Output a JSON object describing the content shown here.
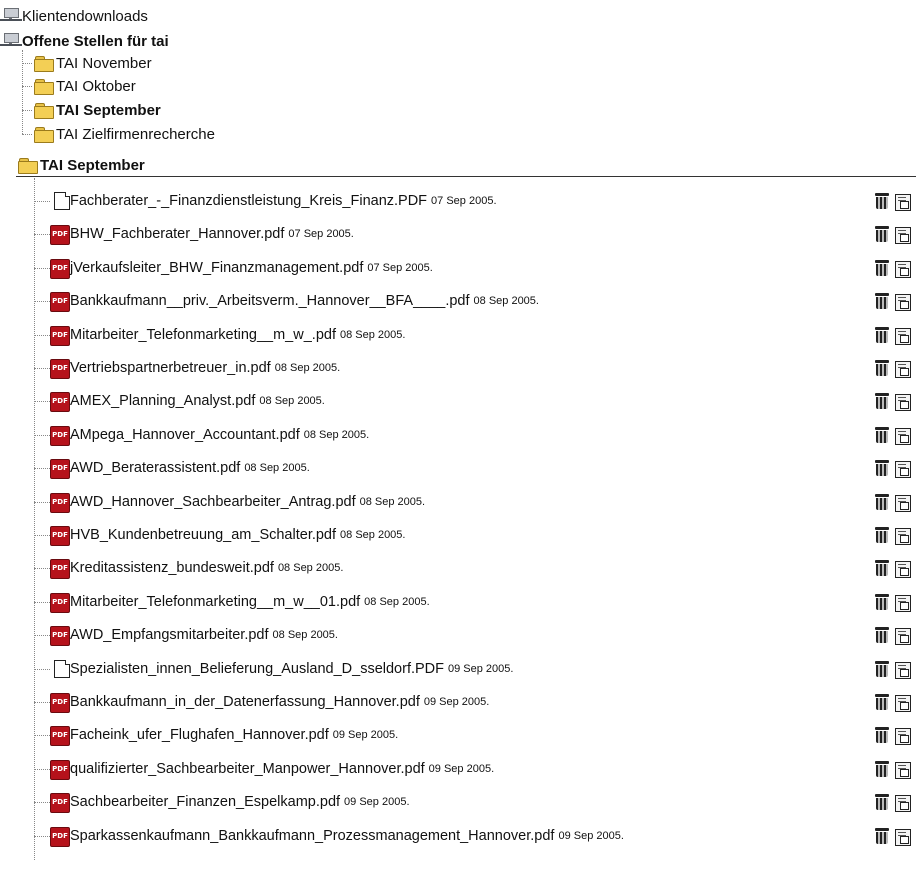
{
  "tree": {
    "root_items": [
      {
        "label": "Klientendownloads",
        "bold": false
      },
      {
        "label": "Offene Stellen für tai",
        "bold": true
      }
    ],
    "folders": [
      {
        "label": "TAI November",
        "bold": false
      },
      {
        "label": "TAI Oktober",
        "bold": false
      },
      {
        "label": "TAI September",
        "bold": true
      },
      {
        "label": "TAI Zielfirmenrecherche",
        "bold": false
      }
    ]
  },
  "section": {
    "title": "TAI September"
  },
  "files": [
    {
      "name": "Fachberater_-_Finanzdienstleistung_Kreis_Finanz.PDF",
      "date": "07 Sep 2005.",
      "icon": "document-icon"
    },
    {
      "name": "BHW_Fachberater_Hannover.pdf",
      "date": "07 Sep 2005.",
      "icon": "pdf-icon"
    },
    {
      "name": "jVerkaufsleiter_BHW_Finanzmanagement.pdf",
      "date": "07 Sep 2005.",
      "icon": "pdf-icon"
    },
    {
      "name": "Bankkaufmann__priv._Arbeitsverm._Hannover__BFA____.pdf",
      "date": "08 Sep 2005.",
      "icon": "pdf-icon"
    },
    {
      "name": "Mitarbeiter_Telefonmarketing__m_w_.pdf",
      "date": "08 Sep 2005.",
      "icon": "pdf-icon"
    },
    {
      "name": "Vertriebspartnerbetreuer_in.pdf",
      "date": "08 Sep 2005.",
      "icon": "pdf-icon"
    },
    {
      "name": "AMEX_Planning_Analyst.pdf",
      "date": "08 Sep 2005.",
      "icon": "pdf-icon"
    },
    {
      "name": "AMpega_Hannover_Accountant.pdf",
      "date": "08 Sep 2005.",
      "icon": "pdf-icon"
    },
    {
      "name": "AWD_Beraterassistent.pdf",
      "date": "08 Sep 2005.",
      "icon": "pdf-icon"
    },
    {
      "name": "AWD_Hannover_Sachbearbeiter_Antrag.pdf",
      "date": "08 Sep 2005.",
      "icon": "pdf-icon"
    },
    {
      "name": "HVB_Kundenbetreuung_am_Schalter.pdf",
      "date": "08 Sep 2005.",
      "icon": "pdf-icon"
    },
    {
      "name": "Kreditassistenz_bundesweit.pdf",
      "date": "08 Sep 2005.",
      "icon": "pdf-icon"
    },
    {
      "name": "Mitarbeiter_Telefonmarketing__m_w__01.pdf",
      "date": "08 Sep 2005.",
      "icon": "pdf-icon"
    },
    {
      "name": "AWD_Empfangsmitarbeiter.pdf",
      "date": "08 Sep 2005.",
      "icon": "pdf-icon"
    },
    {
      "name": "Spezialisten_innen_Belieferung_Ausland_D_sseldorf.PDF",
      "date": "09 Sep 2005.",
      "icon": "document-icon"
    },
    {
      "name": "Bankkaufmann_in_der_Datenerfassung_Hannover.pdf",
      "date": "09 Sep 2005.",
      "icon": "pdf-icon"
    },
    {
      "name": "Facheink_ufer_Flughafen_Hannover.pdf",
      "date": "09 Sep 2005.",
      "icon": "pdf-icon"
    },
    {
      "name": "qualifizierter_Sachbearbeiter_Manpower_Hannover.pdf",
      "date": "09 Sep 2005.",
      "icon": "pdf-icon"
    },
    {
      "name": "Sachbearbeiter_Finanzen_Espelkamp.pdf",
      "date": "09 Sep 2005.",
      "icon": "pdf-icon"
    },
    {
      "name": "Sparkassenkaufmann_Bankkaufmann_Prozessmanagement_Hannover.pdf",
      "date": "09 Sep 2005.",
      "icon": "pdf-icon"
    }
  ],
  "pdf_icon_text": "PDF",
  "row_actions": {
    "delete_icon": "trash-icon",
    "edit_icon": "edit-icon"
  },
  "colors": {
    "pdf_red": "#b5121b",
    "folder_yellow": "#f3cf55"
  }
}
